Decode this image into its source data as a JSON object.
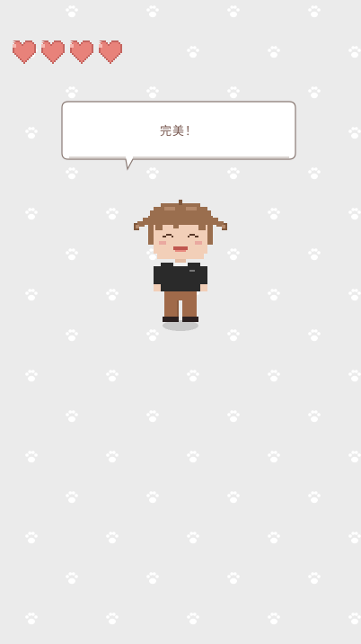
{
  "hud": {
    "hearts_filled": 4,
    "hearts_total": 4
  },
  "dialog": {
    "text": "完美！"
  },
  "character": {
    "expression": "happy"
  },
  "colors": {
    "background": "#ebebeb",
    "paw_print": "#ffffff",
    "heart_fill": "#e8827a",
    "heart_outline": "#c46560",
    "bubble_border": "#8a7a74",
    "hair": "#9a6e4e",
    "shirt": "#2a2a2a",
    "pants": "#a06a4a"
  }
}
